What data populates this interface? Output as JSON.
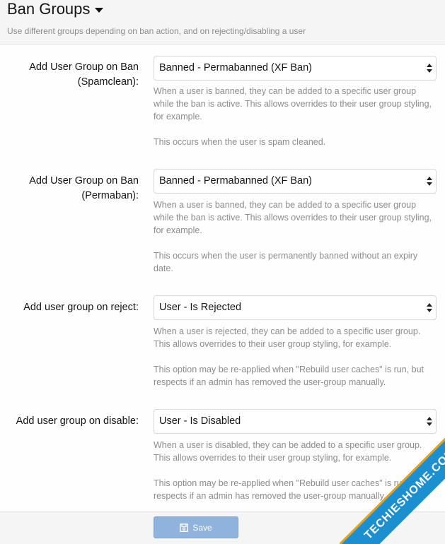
{
  "header": {
    "title": "Ban Groups",
    "subtitle": "Use different groups depending on ban action, and on rejecting/disabling a user"
  },
  "rows": [
    {
      "label_line1": "Add User Group on Ban",
      "label_line2": "(Spamclean):",
      "value": "Banned - Permabanned (XF Ban)",
      "help1": "When a user is banned, they can be added to a specific user group while the ban is active. This allows overrides to their user group styling, for example.",
      "help2": "This occurs when the user is spam cleaned."
    },
    {
      "label_line1": "Add User Group on Ban",
      "label_line2": "(Permaban):",
      "value": "Banned - Permabanned (XF Ban)",
      "help1": "When a user is banned, they can be added to a specific user group while the ban is active. This allows overrides to their user group styling, for example.",
      "help2": "This occurs when the user is permanently banned without an expiry date."
    },
    {
      "label_line1": "Add user group on reject:",
      "label_line2": "",
      "value": "User - Is Rejected",
      "help1": "When a user is rejected, they can be added to a specific user group. This allows overrides to their user group styling, for example.",
      "help2": "This option may be re-applied when \"Rebuild user caches\" is run, but respects if an admin has removed the user-group manually."
    },
    {
      "label_line1": "Add user group on disable:",
      "label_line2": "",
      "value": "User - Is Disabled",
      "help1": "When a user is disabled, they can be added to a specific user group. This allows overrides to their user group styling, for example.",
      "help2": "This option may be re-applied when \"Rebuild user caches\" is run, but respects if an admin has removed the user-group manually."
    }
  ],
  "footer": {
    "save_label": "Save"
  },
  "watermark": {
    "text": "TECHIESHOME.COM"
  },
  "colors": {
    "button": "#8fb3dc",
    "watermark": "#1c8fd1",
    "help_text": "#8c8c8c"
  }
}
